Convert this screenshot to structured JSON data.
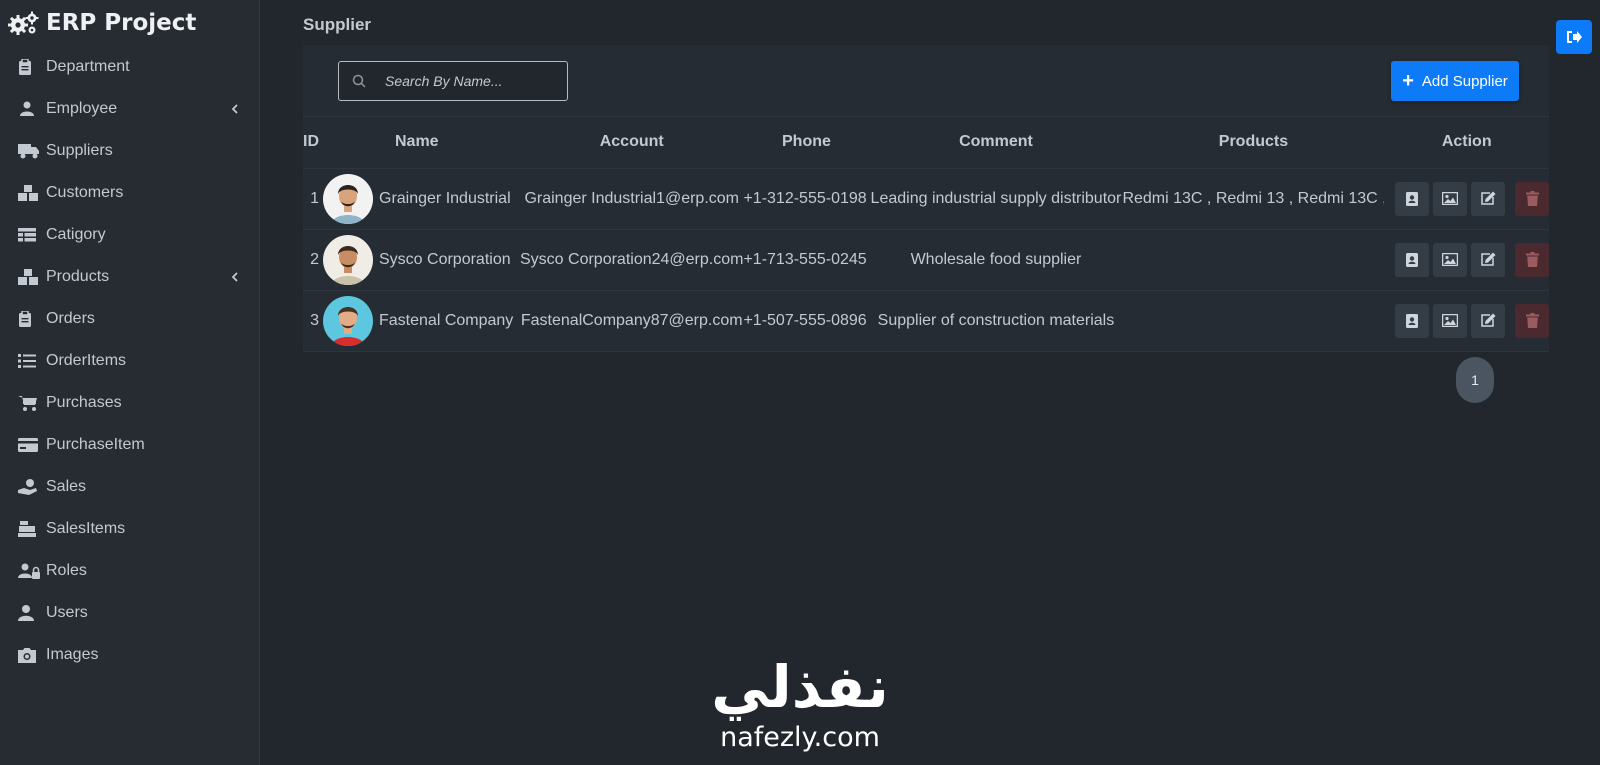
{
  "app": {
    "title": "ERP Project"
  },
  "sidebar": {
    "items": [
      {
        "label": "Department",
        "icon": "clipboard-icon",
        "expandable": false
      },
      {
        "label": "Employee",
        "icon": "users-icon",
        "expandable": true
      },
      {
        "label": "Suppliers",
        "icon": "truck-icon",
        "expandable": false
      },
      {
        "label": "Customers",
        "icon": "boxes-icon",
        "expandable": false
      },
      {
        "label": "Catigory",
        "icon": "table-icon",
        "expandable": false
      },
      {
        "label": "Products",
        "icon": "boxes-icon",
        "expandable": true
      },
      {
        "label": "Orders",
        "icon": "clipboard-icon",
        "expandable": false
      },
      {
        "label": "OrderItems",
        "icon": "list-icon",
        "expandable": false
      },
      {
        "label": "Purchases",
        "icon": "cart-icon",
        "expandable": false
      },
      {
        "label": "PurchaseItem",
        "icon": "credit-card-icon",
        "expandable": false
      },
      {
        "label": "Sales",
        "icon": "hand-dollar-icon",
        "expandable": false
      },
      {
        "label": "SalesItems",
        "icon": "cash-register-icon",
        "expandable": false
      },
      {
        "label": "Roles",
        "icon": "user-lock-icon",
        "expandable": false
      },
      {
        "label": "Users",
        "icon": "user-icon",
        "expandable": false
      },
      {
        "label": "Images",
        "icon": "camera-icon",
        "expandable": false
      }
    ]
  },
  "page": {
    "title": "Supplier"
  },
  "search": {
    "placeholder": "Search By Name..."
  },
  "toolbar": {
    "add_label": "Add Supplier"
  },
  "table": {
    "columns": [
      "ID",
      "Name",
      "Account",
      "Phone",
      "Comment",
      "Products",
      "Action"
    ],
    "rows": [
      {
        "id": "1",
        "name": "Grainger Industrial",
        "account": "Grainger Industrial1@erp.com",
        "phone": "+1-312-555-0198",
        "comment": "Leading industrial supply distributor",
        "products": "Redmi 13C , Redmi 13 , Redmi 13C ,"
      },
      {
        "id": "2",
        "name": "Sysco Corporation",
        "account": "Sysco Corporation24@erp.com",
        "phone": "+1-713-555-0245",
        "comment": "Wholesale food supplier",
        "products": ""
      },
      {
        "id": "3",
        "name": "Fastenal Company",
        "account": "FastenalCompany87@erp.com",
        "phone": "+1-507-555-0896",
        "comment": "Supplier of construction materials",
        "products": ""
      }
    ]
  },
  "pagination": {
    "current": "1"
  },
  "watermark": {
    "arabic": "نفذلي",
    "latin": "nafezly.com"
  },
  "colors": {
    "accent": "#0d7bf7",
    "background": "#22272e",
    "sidebar": "#272c33",
    "danger": "#4a2a2e"
  }
}
